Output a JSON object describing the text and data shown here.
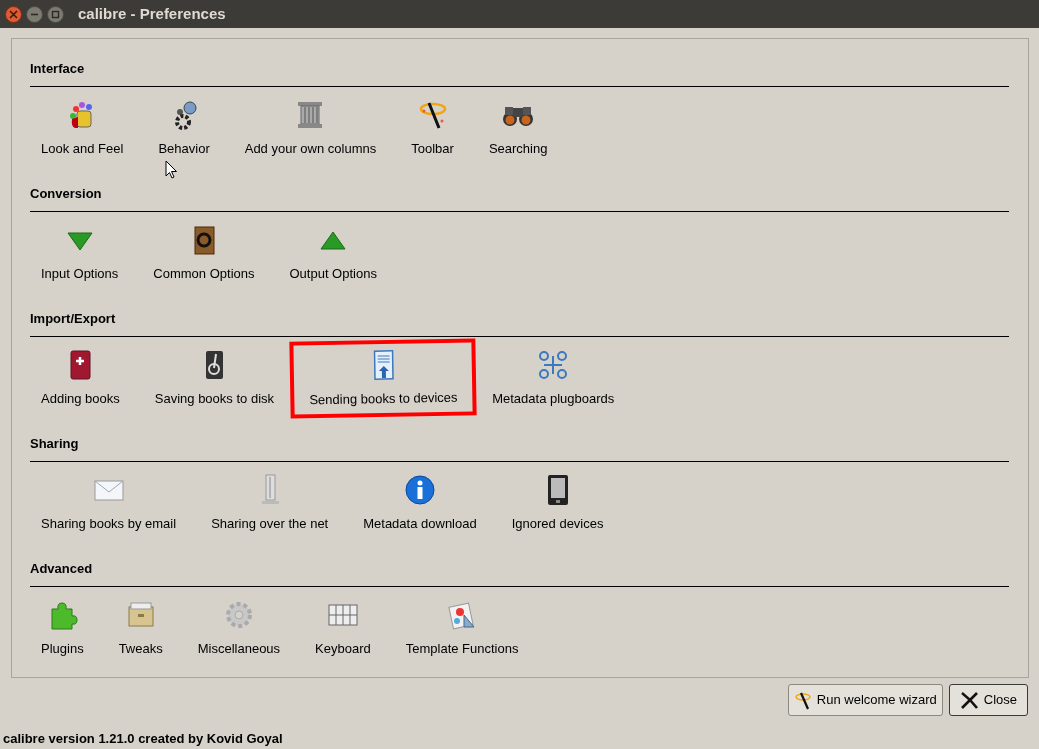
{
  "window": {
    "title": "calibre - Preferences"
  },
  "sections": [
    {
      "title": "Interface",
      "items": [
        {
          "label": "Look and Feel",
          "highlighted": false
        },
        {
          "label": "Behavior",
          "highlighted": false
        },
        {
          "label": "Add your own columns",
          "highlighted": false
        },
        {
          "label": "Toolbar",
          "highlighted": false
        },
        {
          "label": "Searching",
          "highlighted": false
        }
      ]
    },
    {
      "title": "Conversion",
      "items": [
        {
          "label": "Input Options",
          "highlighted": false
        },
        {
          "label": "Common Options",
          "highlighted": false
        },
        {
          "label": "Output Options",
          "highlighted": false
        }
      ]
    },
    {
      "title": "Import/Export",
      "items": [
        {
          "label": "Adding books",
          "highlighted": false
        },
        {
          "label": "Saving books to disk",
          "highlighted": false
        },
        {
          "label": "Sending books to devices",
          "highlighted": true
        },
        {
          "label": "Metadata plugboards",
          "highlighted": false
        }
      ]
    },
    {
      "title": "Sharing",
      "items": [
        {
          "label": "Sharing books by email",
          "highlighted": false
        },
        {
          "label": "Sharing over the net",
          "highlighted": false
        },
        {
          "label": "Metadata download",
          "highlighted": false
        },
        {
          "label": "Ignored devices",
          "highlighted": false
        }
      ]
    },
    {
      "title": "Advanced",
      "items": [
        {
          "label": "Plugins",
          "highlighted": false
        },
        {
          "label": "Tweaks",
          "highlighted": false
        },
        {
          "label": "Miscellaneous",
          "highlighted": false
        },
        {
          "label": "Keyboard",
          "highlighted": false
        },
        {
          "label": "Template Functions",
          "highlighted": false
        }
      ]
    }
  ],
  "buttons": [
    {
      "label": "Run welcome wizard"
    },
    {
      "label": "Close"
    }
  ],
  "status_bar": "calibre version 1.21.0 created by Kovid Goyal"
}
